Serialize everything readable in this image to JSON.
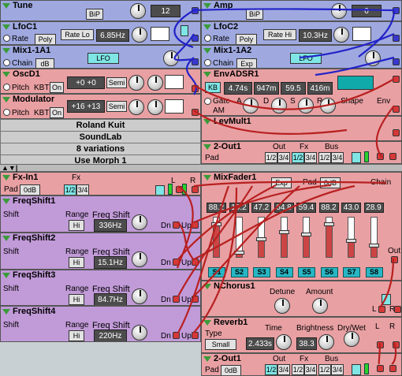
{
  "tune": {
    "title": "Tune",
    "bip": "BiP",
    "value": "12"
  },
  "amp": {
    "title": "Amp",
    "bip": "BiP",
    "value": "0"
  },
  "lfoc1": {
    "title": "LfoC1",
    "rate_label": "Rate",
    "poly": "Poly",
    "rate_mode": "Rate Lo",
    "freq": "6.85Hz"
  },
  "lfoc2": {
    "title": "LfoC2",
    "rate_label": "Rate",
    "poly": "Poly",
    "rate_mode": "Rate Hi",
    "freq": "10.3Hz"
  },
  "mix1_1a1": {
    "title": "Mix1-1A1",
    "chain": "Chain",
    "unit": "dB",
    "source": "LFO"
  },
  "mix1_1a2": {
    "title": "Mix1-1A2",
    "chain": "Chain",
    "unit": "Exp",
    "source": "LFO"
  },
  "osc": {
    "title": "OscD1",
    "pitch": "Pitch",
    "kbt": "KBT",
    "on": "On",
    "value": "+0  +0",
    "mode": "Semi"
  },
  "envadsr": {
    "title": "EnvADSR1",
    "kb": "KB",
    "t1": "4.74s",
    "t2": "947m",
    "t3": "59.5",
    "t4": "416m",
    "gate": "Gate",
    "a": "A",
    "d": "D",
    "s": "S",
    "r": "R",
    "am": "AM",
    "n": "N",
    "shape": "Shape",
    "env": "Env"
  },
  "modulator": {
    "title": "Modulator",
    "pitch": "Pitch",
    "kbt": "KBT",
    "on": "On",
    "value": "+16  +13",
    "mode": "Semi"
  },
  "levmult": {
    "title": "LevMult1"
  },
  "info": [
    "Roland Kuit",
    "SoundLab",
    "8 variations",
    "Use Morph 1"
  ],
  "out2_top": {
    "title": "2-Out1",
    "pad": "Pad",
    "out": "Out",
    "fx": "Fx",
    "bus": "Bus",
    "b12": "1/2",
    "b34": "3/4",
    "fx12": "1/2",
    "fx34": "3/4",
    "bus12": "1/2",
    "bus34": "3/4"
  },
  "toolbar": [
    "▲",
    "▼",
    "|"
  ],
  "fxin": {
    "title": "Fx-In1",
    "fx": "Fx",
    "pad": "Pad",
    "db": "0dB",
    "b12": "1/2",
    "b34": "3/4",
    "l": "L",
    "r": "R"
  },
  "freqshift": [
    {
      "title": "FreqShift1",
      "shift": "Shift",
      "range": "Range",
      "range_val": "Hi",
      "fs": "Freq Shift",
      "val": "336Hz",
      "dn": "Dn",
      "up": "Up"
    },
    {
      "title": "FreqShift2",
      "shift": "Shift",
      "range": "Range",
      "range_val": "Hi",
      "fs": "Freq Shift",
      "val": "15.1Hz",
      "dn": "Dn",
      "up": "Up"
    },
    {
      "title": "FreqShift3",
      "shift": "Shift",
      "range": "Range",
      "range_val": "Hi",
      "fs": "Freq Shift",
      "val": "84.7Hz",
      "dn": "Dn",
      "up": "Up"
    },
    {
      "title": "FreqShift4",
      "shift": "Shift",
      "range": "Range",
      "range_val": "Hi",
      "fs": "Freq Shift",
      "val": "220Hz",
      "dn": "Dn",
      "up": "Up"
    }
  ],
  "mixfader": {
    "title": "MixFader1",
    "exp": "Exp",
    "pad": "Pad",
    "db": "0dB",
    "chain": "Chain",
    "out": "Out",
    "values": [
      "88.2",
      "10.2",
      "47.2",
      "64.8",
      "59.4",
      "88.2",
      "43.0",
      "28.9"
    ],
    "levels": [
      0.88,
      0.1,
      0.47,
      0.65,
      0.59,
      0.88,
      0.43,
      0.29
    ],
    "channels": [
      "S1",
      "S2",
      "S3",
      "S4",
      "S5",
      "S6",
      "S7",
      "S8"
    ]
  },
  "chorus": {
    "title": "NChorus1",
    "detune": "Detune",
    "amount": "Amount",
    "l": "L",
    "r": "R"
  },
  "reverb": {
    "title": "Reverb1",
    "type": "Type",
    "type_val": "Small",
    "time": "Time",
    "time_val": "2.433s",
    "brightness": "Brightness",
    "bright_val": "38.3",
    "drywet": "Dry/Wet",
    "l": "L",
    "r": "R"
  },
  "out2_bottom": {
    "title": "2-Out1",
    "pad": "Pad",
    "db": "0dB",
    "out": "Out",
    "fx": "Fx",
    "bus": "Bus",
    "b12": "1/2",
    "b34": "3/4",
    "fx12": "1/2",
    "fx34": "3/4",
    "bus12": "1/2",
    "bus34": "3/4"
  },
  "colors": {
    "cable_blue": "#2222c8",
    "cable_red": "#b82020",
    "module_blue": "#9fa9e0",
    "module_purple": "#c19ad8",
    "module_pink": "#e9a0a3"
  }
}
